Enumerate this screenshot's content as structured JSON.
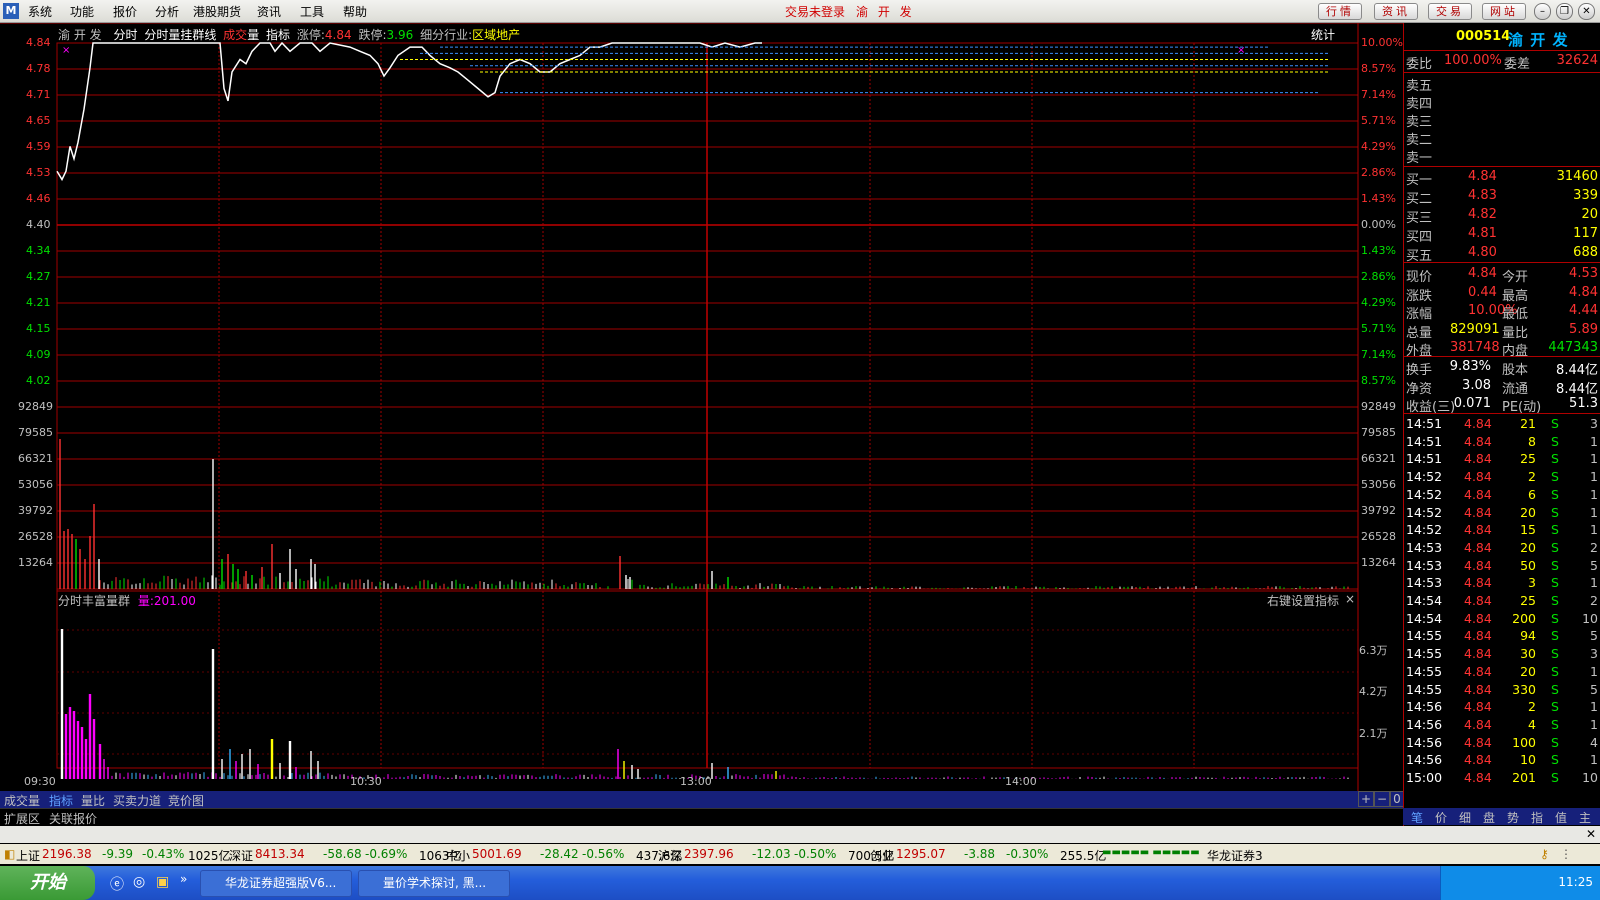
{
  "menu": {
    "items": [
      "系统",
      "功能",
      "报价",
      "分析",
      "港股期货",
      "资讯",
      "工具",
      "帮助"
    ],
    "trade_status": "交易未登录",
    "stock_title": "渝 开 发",
    "buttons": [
      "行情",
      "资讯",
      "交易",
      "网站"
    ]
  },
  "chart_header": {
    "name": "渝 开 发",
    "tabs": [
      "分时",
      "分时量挂群线"
    ],
    "vol_label_1": "成",
    "vol_label_2": "交",
    "vol_label_3": "量",
    "indicator": "指标",
    "limit_up_label": "涨停:",
    "limit_up": "4.84",
    "limit_down_label": "跌停:",
    "limit_down": "3.96",
    "industry_label": "细分行业:",
    "industry": "区域地产",
    "stats": "统计"
  },
  "price_axis": {
    "left": [
      "4.84",
      "4.78",
      "4.71",
      "4.65",
      "4.59",
      "4.53",
      "4.46",
      "4.40",
      "4.34",
      "4.27",
      "4.21",
      "4.15",
      "4.09",
      "4.02"
    ],
    "right": [
      "10.00%",
      "8.57%",
      "7.14%",
      "5.71%",
      "4.29%",
      "2.86%",
      "1.43%",
      "0.00%",
      "1.43%",
      "2.86%",
      "4.29%",
      "5.71%",
      "7.14%",
      "8.57%"
    ]
  },
  "volume_axis": [
    "92849",
    "79585",
    "66321",
    "53056",
    "39792",
    "26528",
    "13264"
  ],
  "lower_panel": {
    "title": "分时丰富量群",
    "vol_label": "量:",
    "vol_value": "201.00",
    "hint": "右键设置指标",
    "axis": [
      "6.3万",
      "4.2万",
      "2.1万"
    ]
  },
  "time_axis": [
    "09:30",
    "10:30",
    "13:00",
    "14:00"
  ],
  "bottom_tabs": [
    "成交量",
    "指标",
    "量比",
    "买卖力道",
    "竞价图"
  ],
  "bottom_tabs2": [
    "扩展区",
    "关联报价"
  ],
  "zoom_buttons": [
    "+",
    "−",
    "0"
  ],
  "quote": {
    "code": "000514",
    "name": "渝 开 发",
    "weibi_label": "委比",
    "weibi": "100.00%",
    "weicha_label": "委差",
    "weicha": "32624",
    "sell": [
      "卖五",
      "卖四",
      "卖三",
      "卖二",
      "卖一"
    ],
    "buy": [
      {
        "label": "买一",
        "price": "4.84",
        "vol": "31460"
      },
      {
        "label": "买二",
        "price": "4.83",
        "vol": "339"
      },
      {
        "label": "买三",
        "price": "4.82",
        "vol": "20"
      },
      {
        "label": "买四",
        "price": "4.81",
        "vol": "117"
      },
      {
        "label": "买五",
        "price": "4.80",
        "vol": "688"
      }
    ],
    "stats": [
      {
        "l1": "现价",
        "v1": "4.84",
        "l2": "今开",
        "v2": "4.53"
      },
      {
        "l1": "涨跌",
        "v1": "0.44",
        "l2": "最高",
        "v2": "4.84"
      },
      {
        "l1": "涨幅",
        "v1": "10.00%",
        "l2": "最低",
        "v2": "4.44"
      },
      {
        "l1": "总量",
        "v1": "829091",
        "l2": "量比",
        "v2": "5.89"
      },
      {
        "l1": "外盘",
        "v1": "381748",
        "l2": "内盘",
        "v2": "447343"
      }
    ],
    "stats2": [
      {
        "l1": "换手",
        "v1": "9.83%",
        "l2": "股本",
        "v2": "8.44亿"
      },
      {
        "l1": "净资",
        "v1": "3.08",
        "l2": "流通",
        "v2": "8.44亿"
      },
      {
        "l1": "收益(三)",
        "v1": "0.071",
        "l2": "PE(动)",
        "v2": "51.3"
      }
    ],
    "ticks": [
      {
        "t": "14:51",
        "p": "4.84",
        "v": "21",
        "s": "S",
        "n": "3"
      },
      {
        "t": "14:51",
        "p": "4.84",
        "v": "8",
        "s": "S",
        "n": "1"
      },
      {
        "t": "14:51",
        "p": "4.84",
        "v": "25",
        "s": "S",
        "n": "1"
      },
      {
        "t": "14:52",
        "p": "4.84",
        "v": "2",
        "s": "S",
        "n": "1"
      },
      {
        "t": "14:52",
        "p": "4.84",
        "v": "6",
        "s": "S",
        "n": "1"
      },
      {
        "t": "14:52",
        "p": "4.84",
        "v": "20",
        "s": "S",
        "n": "1"
      },
      {
        "t": "14:52",
        "p": "4.84",
        "v": "15",
        "s": "S",
        "n": "1"
      },
      {
        "t": "14:53",
        "p": "4.84",
        "v": "20",
        "s": "S",
        "n": "2"
      },
      {
        "t": "14:53",
        "p": "4.84",
        "v": "50",
        "s": "S",
        "n": "5"
      },
      {
        "t": "14:53",
        "p": "4.84",
        "v": "3",
        "s": "S",
        "n": "1"
      },
      {
        "t": "14:54",
        "p": "4.84",
        "v": "25",
        "s": "S",
        "n": "2"
      },
      {
        "t": "14:54",
        "p": "4.84",
        "v": "200",
        "s": "S",
        "n": "10"
      },
      {
        "t": "14:55",
        "p": "4.84",
        "v": "94",
        "s": "S",
        "n": "5"
      },
      {
        "t": "14:55",
        "p": "4.84",
        "v": "30",
        "s": "S",
        "n": "3"
      },
      {
        "t": "14:55",
        "p": "4.84",
        "v": "20",
        "s": "S",
        "n": "1"
      },
      {
        "t": "14:55",
        "p": "4.84",
        "v": "330",
        "s": "S",
        "n": "5"
      },
      {
        "t": "14:56",
        "p": "4.84",
        "v": "2",
        "s": "S",
        "n": "1"
      },
      {
        "t": "14:56",
        "p": "4.84",
        "v": "4",
        "s": "S",
        "n": "1"
      },
      {
        "t": "14:56",
        "p": "4.84",
        "v": "100",
        "s": "S",
        "n": "4"
      },
      {
        "t": "14:56",
        "p": "4.84",
        "v": "10",
        "s": "S",
        "n": "1"
      },
      {
        "t": "15:00",
        "p": "4.84",
        "v": "201",
        "s": "S",
        "n": "10"
      }
    ],
    "right_tabs": [
      "笔",
      "价",
      "细",
      "盘",
      "势",
      "指",
      "值",
      "主"
    ]
  },
  "index_bar": [
    {
      "name": "上证",
      "val": "2196.38",
      "chg": "-9.39",
      "pct": "-0.43%",
      "amt": "1025亿"
    },
    {
      "name": "深证",
      "val": "8413.34",
      "chg": "-58.68",
      "pct": "-0.69%",
      "amt": "1063亿"
    },
    {
      "name": "中小",
      "val": "5001.69",
      "chg": "-28.42",
      "pct": "-0.56%",
      "amt": "437.6亿"
    },
    {
      "name": "沪深",
      "val": "2397.96",
      "chg": "-12.03",
      "pct": "-0.50%",
      "amt": "700.5亿"
    },
    {
      "name": "创业",
      "val": "1295.07",
      "chg": "-3.88",
      "pct": "-0.30%",
      "amt": "255.5亿"
    }
  ],
  "broker": "华龙证券3",
  "taskbar": {
    "start": "开始",
    "items": [
      "华龙证券超强版V6...",
      "量价学术探讨, 黑..."
    ],
    "clock": "11:25"
  },
  "colors": {
    "up": "#ff3232",
    "down": "#00e000",
    "grid": "#a00000",
    "price_line": "#ffffff",
    "accent_yellow": "#ffff00",
    "accent_magenta": "#ff00ff"
  }
}
